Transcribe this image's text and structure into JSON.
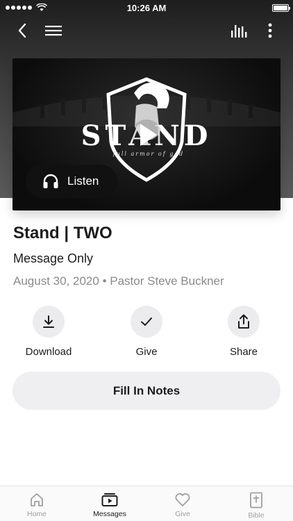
{
  "status_bar": {
    "time": "10:26 AM"
  },
  "video": {
    "logo_text": "STAND",
    "logo_tagline": "full armor of god",
    "listen_label": "Listen"
  },
  "message": {
    "title": "Stand | TWO",
    "subtitle": "Message Only",
    "date": "August 30, 2020",
    "speaker": "Pastor Steve Buckner"
  },
  "actions": {
    "download": "Download",
    "give": "Give",
    "share": "Share"
  },
  "notes_button": "Fill In Notes",
  "tabs": [
    {
      "label": "Home",
      "icon": "home-icon",
      "active": false
    },
    {
      "label": "Messages",
      "icon": "play-box-icon",
      "active": true
    },
    {
      "label": "Give",
      "icon": "heart-icon",
      "active": false
    },
    {
      "label": "Bible",
      "icon": "bible-icon",
      "active": false
    }
  ]
}
